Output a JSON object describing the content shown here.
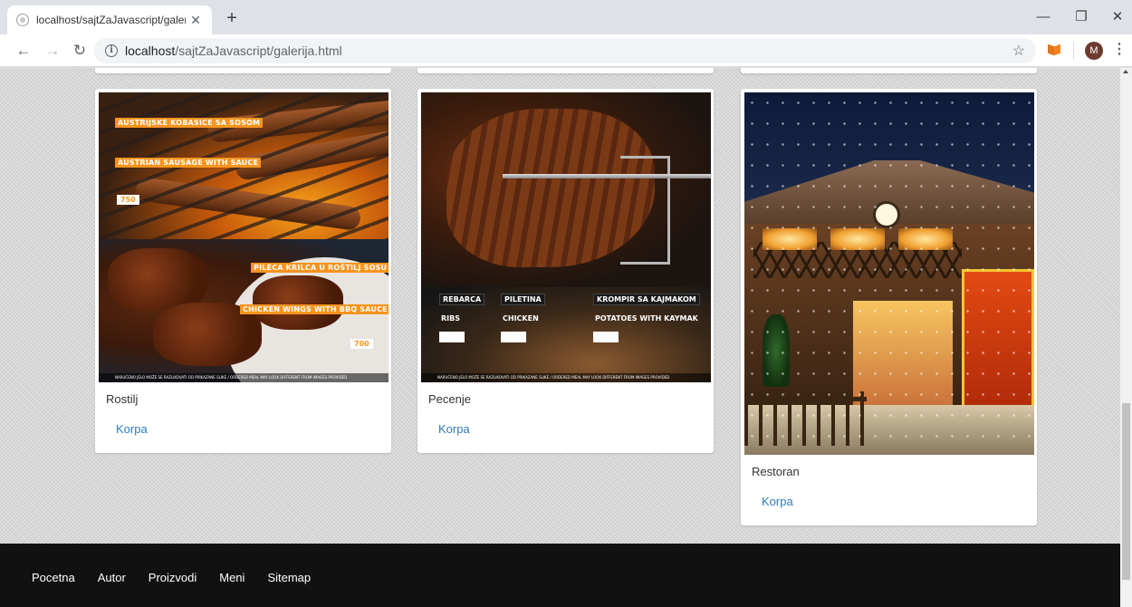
{
  "browser": {
    "tab_title": "localhost/sajtZaJavascript/galerija",
    "url_host": "localhost",
    "url_path": "/sajtZaJavascript/galerija.html",
    "profile_initial": "M"
  },
  "gallery": [
    {
      "caption": "Rostilj",
      "action": "Korpa",
      "menu": {
        "item1_sr": "AUSTRIJSKE KOBASICE SA SOSOM",
        "item1_en": "AUSTRIAN SAUSAGE WITH SAUCE",
        "item1_price": "750",
        "item2_sr": "PILECA KRILCA U ROŠTILJ SOSU",
        "item2_en": "CHICKEN WINGS WITH BBQ SAUCE",
        "item2_price": "700",
        "footnote": "NARUČENO JELO MOŽE SE RAZLIKOVATI OD PRIKAZANE SLIKE / ORDERED MEAL MAY LOOK DIFFERENT FROM IMAGES PROVIDED"
      }
    },
    {
      "caption": "Pecenje",
      "action": "Korpa",
      "menu": {
        "rebarca": "REBARCA",
        "piletina": "PILETINA",
        "krompir": "KROMPIR SA KAJMAKOM",
        "ribs": "RIBS",
        "chicken": "CHICKEN",
        "potatoes": "POTATOES WITH KAYMAK",
        "footnote": "NARUČENO JELO MOŽE SE RAZLIKOVATI OD PRIKAZANE SLIKE / ORDERED MEAL MAY LOOK DIFFERENT FROM IMAGES PROVIDED"
      }
    },
    {
      "caption": "Restoran",
      "action": "Korpa"
    }
  ],
  "footer": {
    "links": [
      "Pocetna",
      "Autor",
      "Proizvodi",
      "Meni",
      "Sitemap"
    ]
  },
  "colors": {
    "link": "#337ab7",
    "footer_bg": "#111111",
    "menu_accent": "#f7941d"
  }
}
